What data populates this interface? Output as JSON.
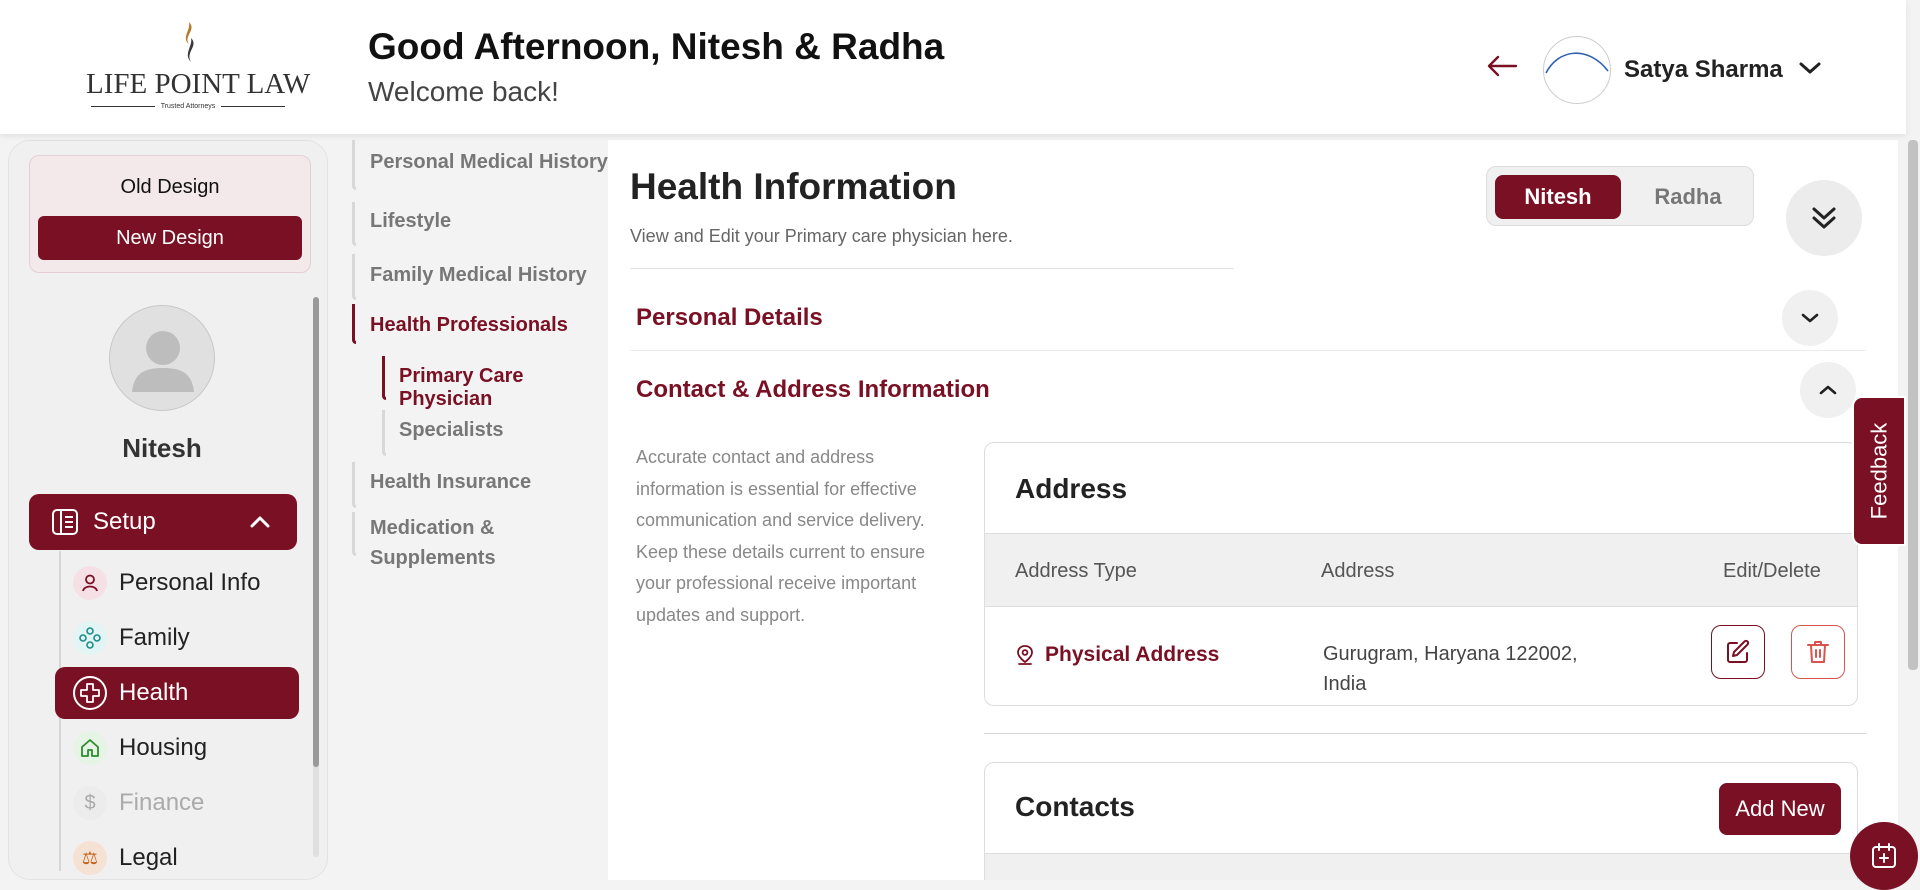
{
  "header": {
    "logo_text": "LIFE POINT LAW",
    "logo_tagline": "Trusted Attorneys",
    "greeting": "Good Afternoon, Nitesh & Radha",
    "welcome": "Welcome back!",
    "user_name": "Satya Sharma"
  },
  "sidebar": {
    "old_design": "Old Design",
    "new_design": "New Design",
    "profile_name": "Nitesh",
    "setup_label": "Setup",
    "items": [
      {
        "label": "Personal Info",
        "icon": "person-icon",
        "state": "normal"
      },
      {
        "label": "Family",
        "icon": "family-icon",
        "state": "normal"
      },
      {
        "label": "Health",
        "icon": "health-cross-icon",
        "state": "active"
      },
      {
        "label": "Housing",
        "icon": "house-icon",
        "state": "normal"
      },
      {
        "label": "Finance",
        "icon": "dollar-icon",
        "state": "disabled"
      },
      {
        "label": "Legal",
        "icon": "legal-icon",
        "state": "normal"
      }
    ]
  },
  "section_nav": {
    "items": [
      {
        "label": "Personal Medical History",
        "state": "normal"
      },
      {
        "label": "Lifestyle",
        "state": "normal"
      },
      {
        "label": "Family Medical History",
        "state": "normal"
      },
      {
        "label": "Health Professionals",
        "state": "active"
      },
      {
        "label": "Primary Care Physician",
        "state": "active-sub"
      },
      {
        "label": "Specialists",
        "state": "sub"
      },
      {
        "label": "Health Insurance",
        "state": "normal"
      },
      {
        "label": "Medication & Supplements",
        "state": "normal"
      }
    ]
  },
  "main": {
    "title": "Health Information",
    "subtitle": "View and Edit your Primary care physician here.",
    "person_toggle": {
      "selected": "Nitesh",
      "other": "Radha"
    },
    "personal_details": "Personal Details",
    "contact_section": "Contact & Address Information",
    "contact_description": "Accurate contact and address information is essential for effective communication and service delivery. Keep these details current to ensure your professional receive important updates and support.",
    "address_card": {
      "title": "Address",
      "columns": [
        "Address Type",
        "Address",
        "Edit/Delete"
      ],
      "rows": [
        {
          "type": "Physical Address",
          "address": "Gurugram, Haryana 122002, India"
        }
      ]
    },
    "contacts_card": {
      "title": "Contacts",
      "add_new": "Add New"
    }
  },
  "feedback_label": "Feedback",
  "colors": {
    "accent": "#7a1024",
    "background": "#f3f3f3"
  }
}
